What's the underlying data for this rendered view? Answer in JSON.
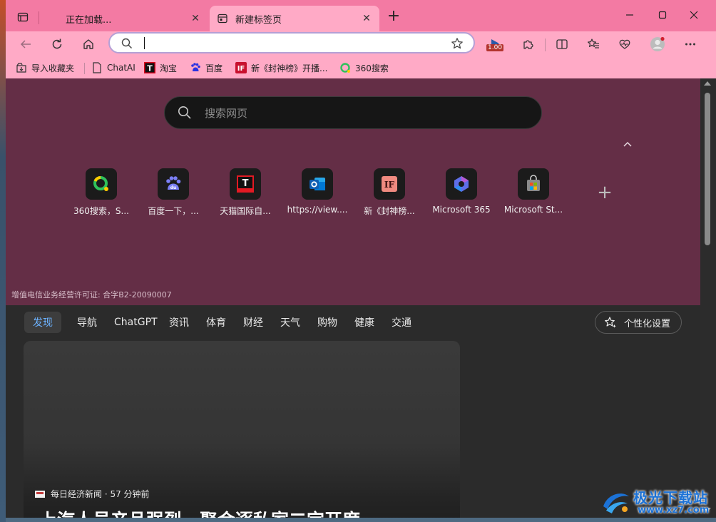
{
  "browser": {
    "tabs": [
      {
        "title": "正在加载...",
        "active": false
      },
      {
        "title": "新建标签页",
        "active": true
      }
    ],
    "new_tab_symbol": "+",
    "address_placeholder": "",
    "media_badge": "1.00",
    "bookmarks": [
      {
        "label": "导入收藏夹",
        "icon": "import-icon"
      },
      {
        "label": "ChatAI",
        "icon": "page-icon"
      },
      {
        "label": "淘宝",
        "icon": "taobao-icon"
      },
      {
        "label": "百度",
        "icon": "baidu-icon"
      },
      {
        "label": "新《封神榜》开播...",
        "icon": "fengshen-icon"
      },
      {
        "label": "360搜索",
        "icon": "360-icon"
      }
    ]
  },
  "newtab": {
    "search_placeholder": "搜索网页",
    "quick_links": [
      {
        "label": "360搜索，S...",
        "icon": "360-icon"
      },
      {
        "label": "百度一下，...",
        "icon": "baidu-icon"
      },
      {
        "label": "天猫国际自...",
        "icon": "tmall-icon"
      },
      {
        "label": "https://view....",
        "icon": "outlook-icon"
      },
      {
        "label": "新《封神榜...",
        "icon": "fengshen-icon"
      },
      {
        "label": "Microsoft 365",
        "icon": "m365-icon"
      },
      {
        "label": "Microsoft St...",
        "icon": "store-icon"
      }
    ],
    "license": "增值电信业务经营许可证: 合字B2-20090007",
    "feed_tabs": [
      "发现",
      "导航",
      "ChatGPT",
      "资讯",
      "体育",
      "财经",
      "天气",
      "购物",
      "健康",
      "交通"
    ],
    "active_feed_tab": "发现",
    "personalize_label": "个性化设置",
    "card": {
      "source": "每日经济新闻 · 57 分钟前",
      "headline": "上汽人员产品强烈，聚会逐私家二定开度"
    }
  },
  "watermark": {
    "brand": "极光下载站",
    "url": "www.xz7.com"
  },
  "colors": {
    "tabstrip": "#f37aa3",
    "toolbar": "#ffaac6",
    "hero": "#642e46",
    "accent": "#6cb2ff"
  }
}
